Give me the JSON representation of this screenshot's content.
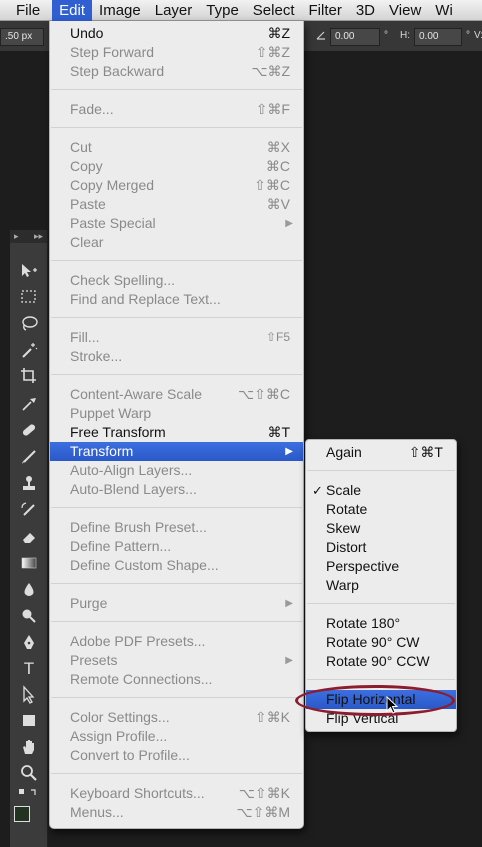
{
  "menubar": {
    "apple": "",
    "items": [
      {
        "label": "File"
      },
      {
        "label": "Edit"
      },
      {
        "label": "Image"
      },
      {
        "label": "Layer"
      },
      {
        "label": "Type"
      },
      {
        "label": "Select"
      },
      {
        "label": "Filter"
      },
      {
        "label": "3D"
      },
      {
        "label": "View"
      },
      {
        "label": "Wi"
      }
    ],
    "active": "Edit"
  },
  "options_bar": {
    "width_value": ".50 px",
    "angle_value": "0.00",
    "angle_unit": "°",
    "h_label": "H:",
    "h_value": "0.00",
    "h_unit": "°",
    "v_label": "V:"
  },
  "tools_panel": {
    "header_left": "▸",
    "header_right": "▸▸",
    "tools": [
      "move-tool",
      "marquee-tool",
      "lasso-tool",
      "magic-wand-tool",
      "crop-tool",
      "eyedropper-tool",
      "healing-brush-tool",
      "brush-tool",
      "clone-stamp-tool",
      "history-brush-tool",
      "eraser-tool",
      "gradient-tool",
      "blur-tool",
      "dodge-tool",
      "pen-tool",
      "type-tool",
      "path-selection-tool",
      "rectangle-tool",
      "hand-tool",
      "zoom-tool"
    ],
    "type_label": "T"
  },
  "edit_menu": {
    "items": [
      {
        "label": "Undo",
        "shortcut": "⌘Z",
        "enabled": true
      },
      {
        "label": "Step Forward",
        "shortcut": "⇧⌘Z",
        "enabled": false
      },
      {
        "label": "Step Backward",
        "shortcut": "⌥⌘Z",
        "enabled": false
      },
      {
        "label": "Fade...",
        "shortcut": "⇧⌘F",
        "enabled": false
      },
      {
        "label": "Cut",
        "shortcut": "⌘X",
        "enabled": false
      },
      {
        "label": "Copy",
        "shortcut": "⌘C",
        "enabled": false
      },
      {
        "label": "Copy Merged",
        "shortcut": "⇧⌘C",
        "enabled": false
      },
      {
        "label": "Paste",
        "shortcut": "⌘V",
        "enabled": false
      },
      {
        "label": "Paste Special",
        "shortcut": "",
        "submenu": true,
        "enabled": false
      },
      {
        "label": "Clear",
        "shortcut": "",
        "enabled": false
      },
      {
        "label": "Check Spelling...",
        "shortcut": "",
        "enabled": false
      },
      {
        "label": "Find and Replace Text...",
        "shortcut": "",
        "enabled": false
      },
      {
        "label": "Fill...",
        "shortcut": "⇧F5",
        "enabled": false
      },
      {
        "label": "Stroke...",
        "shortcut": "",
        "enabled": false
      },
      {
        "label": "Content-Aware Scale",
        "shortcut": "⌥⇧⌘C",
        "enabled": false
      },
      {
        "label": "Puppet Warp",
        "shortcut": "",
        "enabled": false
      },
      {
        "label": "Free Transform",
        "shortcut": "⌘T",
        "enabled": true
      },
      {
        "label": "Transform",
        "shortcut": "",
        "submenu": true,
        "enabled": true,
        "highlight": true
      },
      {
        "label": "Auto-Align Layers...",
        "shortcut": "",
        "enabled": false
      },
      {
        "label": "Auto-Blend Layers...",
        "shortcut": "",
        "enabled": false
      },
      {
        "label": "Define Brush Preset...",
        "shortcut": "",
        "enabled": false
      },
      {
        "label": "Define Pattern...",
        "shortcut": "",
        "enabled": false
      },
      {
        "label": "Define Custom Shape...",
        "shortcut": "",
        "enabled": false
      },
      {
        "label": "Purge",
        "shortcut": "",
        "submenu": true,
        "enabled": false
      },
      {
        "label": "Adobe PDF Presets...",
        "shortcut": "",
        "enabled": false
      },
      {
        "label": "Presets",
        "shortcut": "",
        "submenu": true,
        "enabled": false
      },
      {
        "label": "Remote Connections...",
        "shortcut": "",
        "enabled": false
      },
      {
        "label": "Color Settings...",
        "shortcut": "⇧⌘K",
        "enabled": false
      },
      {
        "label": "Assign Profile...",
        "shortcut": "",
        "enabled": false
      },
      {
        "label": "Convert to Profile...",
        "shortcut": "",
        "enabled": false
      },
      {
        "label": "Keyboard Shortcuts...",
        "shortcut": "⌥⇧⌘K",
        "enabled": false
      },
      {
        "label": "Menus...",
        "shortcut": "⌥⇧⌘M",
        "enabled": false
      }
    ]
  },
  "transform_submenu": {
    "items": [
      {
        "label": "Again",
        "shortcut": "⇧⌘T"
      },
      {
        "label": "Scale",
        "checked": true
      },
      {
        "label": "Rotate"
      },
      {
        "label": "Skew"
      },
      {
        "label": "Distort"
      },
      {
        "label": "Perspective"
      },
      {
        "label": "Warp"
      },
      {
        "label": "Rotate 180°"
      },
      {
        "label": "Rotate 90° CW"
      },
      {
        "label": "Rotate 90° CCW"
      },
      {
        "label": "Flip Horizontal",
        "highlight": true
      },
      {
        "label": "Flip Vertical"
      }
    ],
    "check_mark": "✓"
  }
}
